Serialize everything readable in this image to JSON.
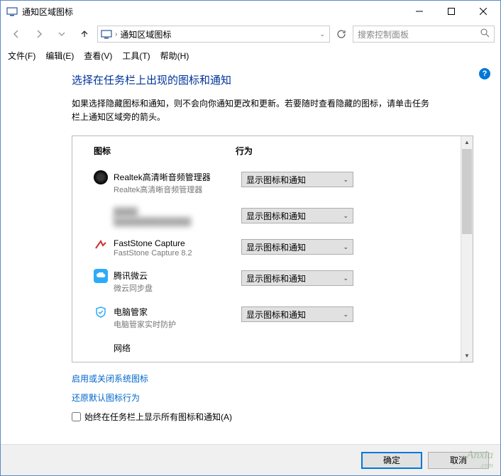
{
  "window": {
    "title": "通知区域图标"
  },
  "nav": {
    "breadcrumb": "通知区域图标",
    "search_placeholder": "搜索控制面板"
  },
  "menu": {
    "file": "文件(F)",
    "edit": "编辑(E)",
    "view": "查看(V)",
    "tools": "工具(T)",
    "help": "帮助(H)"
  },
  "page": {
    "heading": "选择在任务栏上出现的图标和通知",
    "description": "如果选择隐藏图标和通知，则不会向你通知更改和更新。若要随时查看隐藏的图标，请单击任务栏上通知区域旁的箭头。",
    "col_icon": "图标",
    "col_behavior": "行为"
  },
  "items": [
    {
      "name": "Realtek高清晰音频管理器",
      "sub": "Realtek高清晰音频管理器",
      "behavior": "显示图标和通知",
      "icon": "realtek"
    },
    {
      "name": "████",
      "sub": "██████████████",
      "behavior": "显示图标和通知",
      "icon": "blur",
      "blurred": true
    },
    {
      "name": "FastStone Capture",
      "sub": "FastStone Capture 8.2",
      "behavior": "显示图标和通知",
      "icon": "faststone"
    },
    {
      "name": "腾讯微云",
      "sub": "微云同步盘",
      "behavior": "显示图标和通知",
      "icon": "tencent"
    },
    {
      "name": "电脑管家",
      "sub": "电脑管家实时防护",
      "behavior": "显示图标和通知",
      "icon": "guanjia"
    },
    {
      "name": "网络",
      "sub": "",
      "behavior": "",
      "icon": ""
    }
  ],
  "links": {
    "toggle_system": "启用或关闭系统图标",
    "restore_default": "还原默认图标行为"
  },
  "checkbox": {
    "label": "始终在任务栏上显示所有图标和通知(A)"
  },
  "buttons": {
    "ok": "确定",
    "cancel": "取消"
  },
  "watermark": {
    "main": "Anxia",
    "sub": ".com"
  }
}
